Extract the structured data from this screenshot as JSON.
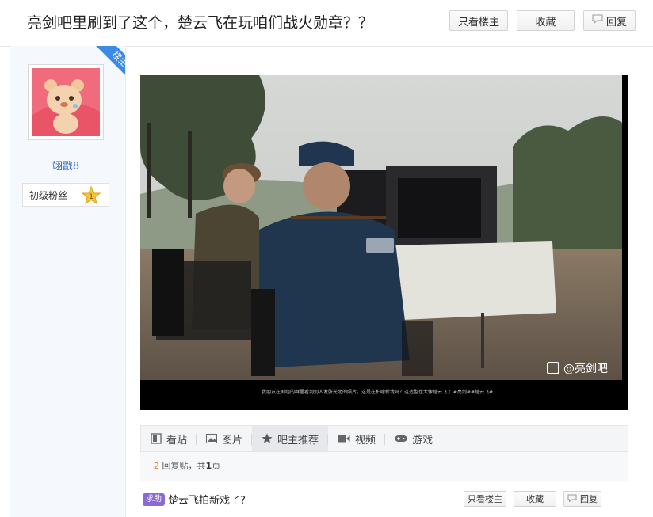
{
  "header": {
    "title": "亮剑吧里刷到了这个，楚云飞在玩咱们战火勋章？？",
    "only_op_label": "只看楼主",
    "favorite_label": "收藏",
    "reply_label": "回复"
  },
  "author": {
    "corner_badge": "楼主",
    "username": "翊戬8",
    "level_label": "初级粉丝",
    "level_number": "1"
  },
  "post": {
    "subtitle_text": "我朋友在剧组的群里看到别人发张光北的照片，这是在拍啥新戏吗？这造型也太像楚云飞了 #亮剑##楚云飞#",
    "watermark": "@亮剑吧"
  },
  "tabs": [
    {
      "label": "看贴",
      "icon": "post-icon"
    },
    {
      "label": "图片",
      "icon": "image-icon"
    },
    {
      "label": "吧主推荐",
      "icon": "star-icon"
    },
    {
      "label": "视频",
      "icon": "video-icon"
    },
    {
      "label": "游戏",
      "icon": "gamepad-icon"
    }
  ],
  "stats": {
    "reply_count": "2",
    "reply_text": "回复贴，共",
    "page_count": "1",
    "page_text": "页"
  },
  "related": {
    "tag": "求助",
    "title": "楚云飞拍新戏了?",
    "only_op_label": "只看楼主",
    "favorite_label": "收藏",
    "reply_label": "回复"
  },
  "colors": {
    "accent_blue": "#3b8ae6",
    "username_blue": "#2d64b3",
    "tag_purple": "#8b6ad6",
    "count_orange": "#e07a1f"
  }
}
